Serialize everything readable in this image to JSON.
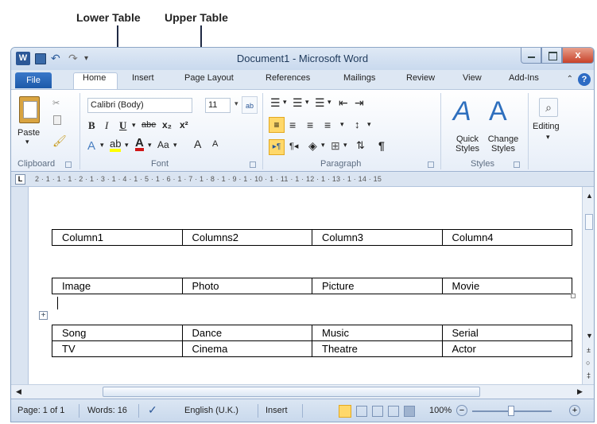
{
  "annotations": {
    "lower_table": "Lower Table",
    "upper_table": "Upper Table"
  },
  "window": {
    "title": "Document1 - Microsoft Word"
  },
  "tabs": [
    "File",
    "Home",
    "Insert",
    "Page Layout",
    "References",
    "Mailings",
    "Review",
    "View",
    "Add-Ins"
  ],
  "ribbon": {
    "paste_label": "Paste",
    "font_name": "Calibri (Body)",
    "font_size": "11",
    "quick_styles": "Quick Styles",
    "change_styles": "Change Styles",
    "editing": "Editing",
    "groups": {
      "clipboard": "Clipboard",
      "font": "Font",
      "paragraph": "Paragraph",
      "styles": "Styles"
    }
  },
  "ruler": {
    "text": "2 · 1 · 1 · 1 · 2 · 1 · 3 · 1 · 4 · 1 · 5 · 1 · 6 · 1 · 7 · 1 · 8 · 1 · 9 · 1 · 10 · 1 · 11 · 1 · 12 · 1 · 13 · 1 · 14 · 15"
  },
  "document": {
    "upper_table": [
      [
        "Column1",
        "Columns2",
        "Column3",
        "Column4"
      ]
    ],
    "lower_table_first": [
      [
        "Image",
        "Photo",
        "Picture",
        "Movie"
      ]
    ],
    "bottom_table": [
      [
        "Song",
        "Dance",
        "Music",
        "Serial"
      ],
      [
        "TV",
        "Cinema",
        "Theatre",
        "Actor"
      ]
    ]
  },
  "status": {
    "page": "Page: 1 of 1",
    "words": "Words: 16",
    "language": "English (U.K.)",
    "mode": "Insert",
    "zoom": "100%"
  }
}
